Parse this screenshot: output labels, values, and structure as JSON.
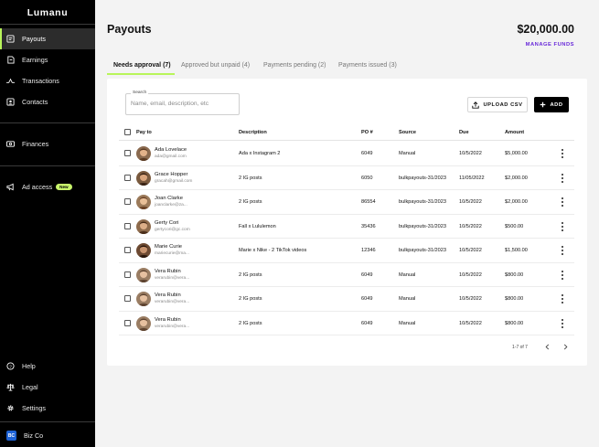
{
  "sidebar": {
    "brand": "Lumanu",
    "items": [
      {
        "label": "Payouts",
        "icon": "payouts-icon"
      },
      {
        "label": "Earnings",
        "icon": "earnings-icon"
      },
      {
        "label": "Transactions",
        "icon": "transactions-icon"
      },
      {
        "label": "Contacts",
        "icon": "contacts-icon"
      },
      {
        "label": "Finances",
        "icon": "finances-icon"
      },
      {
        "label": "Ad access",
        "icon": "megaphone-icon",
        "badge": "New"
      },
      {
        "label": "Help",
        "icon": "help-icon"
      },
      {
        "label": "Legal",
        "icon": "legal-icon"
      },
      {
        "label": "Settings",
        "icon": "gear-icon"
      }
    ],
    "account": {
      "initials": "BC",
      "name": "Biz Co"
    },
    "active_color": "#b8f55a"
  },
  "header": {
    "title": "Payouts",
    "balance": "$20,000.00",
    "manage_funds": "MANAGE FUNDS"
  },
  "tabs": [
    {
      "label": "Needs approval (7)",
      "active": true
    },
    {
      "label": "Approved but unpaid (4)",
      "active": false
    },
    {
      "label": "Payments pending (2)",
      "active": false
    },
    {
      "label": "Payments issued (3)",
      "active": false
    }
  ],
  "search": {
    "label": "Search",
    "placeholder": "Name, email, description, etc"
  },
  "actions": {
    "upload": "UPLOAD CSV",
    "add": "ADD"
  },
  "table": {
    "columns": [
      "Pay to",
      "Description",
      "PO #",
      "Source",
      "Due",
      "Amount"
    ],
    "rows": [
      {
        "name": "Ada Lovelace",
        "email": "ada@gmail.com",
        "description": "Ada x Instagram 2",
        "po": "6049",
        "source": "Manual",
        "due": "10/5/2022",
        "amount": "$5,000.00"
      },
      {
        "name": "Grace Hopper",
        "email": "gracah@gmail.com",
        "description": "2 IG posts",
        "po": "6050",
        "source": "bulkpayouts-31/2023",
        "due": "11/05/2022",
        "amount": "$2,000.00"
      },
      {
        "name": "Joan Clarke",
        "email": "joanclarke@za...",
        "description": "2 IG posts",
        "po": "86554",
        "source": "bulkpayouts-31/2023",
        "due": "10/5/2022",
        "amount": "$2,000.00"
      },
      {
        "name": "Gerty Cori",
        "email": "gertycori@gc.com",
        "description": "Fall x Lululemon",
        "po": "35436",
        "source": "bulkpayouts-31/2023",
        "due": "10/5/2022",
        "amount": "$500.00"
      },
      {
        "name": "Marie Curie",
        "email": "mariecurie@ma...",
        "description": "Marie x Nike - 2 TikTok videos",
        "po": "12346",
        "source": "bulkpayouts-31/2023",
        "due": "10/5/2022",
        "amount": "$1,500.00"
      },
      {
        "name": "Vera Rubin",
        "email": "verarubin@vera...",
        "description": "2 IG posts",
        "po": "6049",
        "source": "Manual",
        "due": "10/5/2022",
        "amount": "$800.00"
      },
      {
        "name": "Vera Rubin",
        "email": "verarubin@vera...",
        "description": "2 IG posts",
        "po": "6049",
        "source": "Manual",
        "due": "10/5/2022",
        "amount": "$800.00"
      },
      {
        "name": "Vera Rubin",
        "email": "verarubin@vera...",
        "description": "2 IG posts",
        "po": "6049",
        "source": "Manual",
        "due": "10/5/2022",
        "amount": "$800.00"
      }
    ]
  },
  "pagination": {
    "text": "1-7 of 7"
  }
}
